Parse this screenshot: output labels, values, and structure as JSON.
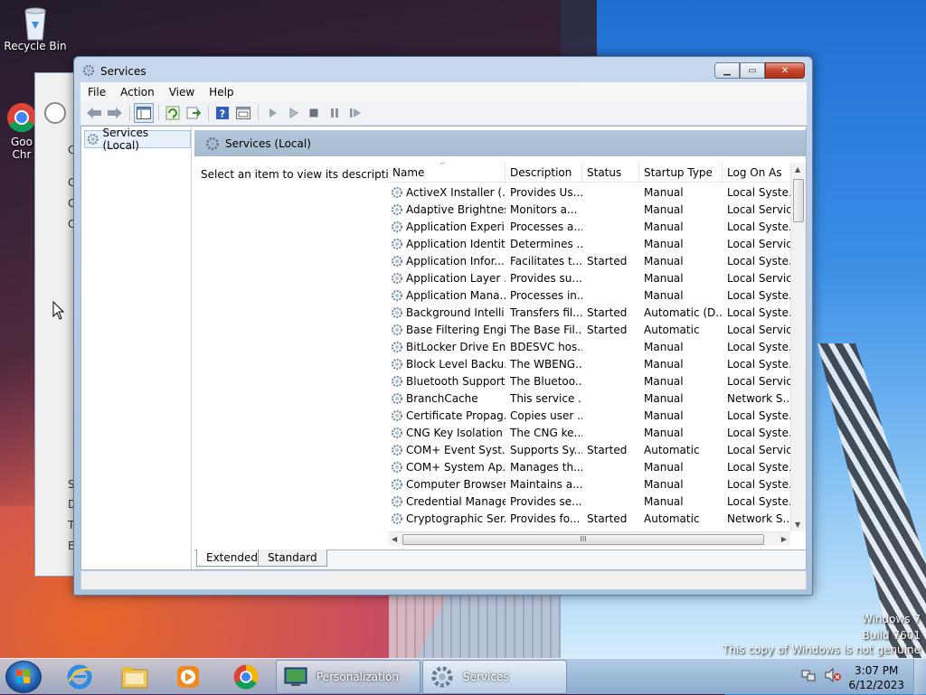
{
  "desktop": {
    "recycle_bin_label": "Recycle Bin",
    "chrome_label_line1": "Goo",
    "chrome_label_line2": "Chr",
    "watermark": {
      "line1": "Windows 7",
      "line2": "Build 7601",
      "line3": "This copy of Windows is not genuine"
    },
    "bg_window_fragments": [
      "C",
      "C",
      "C",
      "C",
      "S",
      "D",
      "T",
      "E"
    ]
  },
  "window": {
    "title": "Services",
    "menu": [
      "File",
      "Action",
      "View",
      "Help"
    ],
    "tree_item": "Services (Local)",
    "header": "Services (Local)",
    "description_prompt": "Select an item to view its description.",
    "columns": [
      "Name",
      "Description",
      "Status",
      "Startup Type",
      "Log On As"
    ],
    "services": [
      {
        "name": "ActiveX Installer (...",
        "description": "Provides Us...",
        "status": "",
        "startup": "Manual",
        "logon": "Local Syste..."
      },
      {
        "name": "Adaptive Brightness",
        "description": "Monitors a...",
        "status": "",
        "startup": "Manual",
        "logon": "Local Service"
      },
      {
        "name": "Application Experi...",
        "description": "Processes a...",
        "status": "",
        "startup": "Manual",
        "logon": "Local Syste..."
      },
      {
        "name": "Application Identity",
        "description": "Determines ...",
        "status": "",
        "startup": "Manual",
        "logon": "Local Service"
      },
      {
        "name": "Application Infor...",
        "description": "Facilitates t...",
        "status": "Started",
        "startup": "Manual",
        "logon": "Local Syste..."
      },
      {
        "name": "Application Layer ...",
        "description": "Provides su...",
        "status": "",
        "startup": "Manual",
        "logon": "Local Service"
      },
      {
        "name": "Application Mana...",
        "description": "Processes in...",
        "status": "",
        "startup": "Manual",
        "logon": "Local Syste..."
      },
      {
        "name": "Background Intelli...",
        "description": "Transfers fil...",
        "status": "Started",
        "startup": "Automatic (D...",
        "logon": "Local Syste..."
      },
      {
        "name": "Base Filtering Engi...",
        "description": "The Base Fil...",
        "status": "Started",
        "startup": "Automatic",
        "logon": "Local Service"
      },
      {
        "name": "BitLocker Drive En...",
        "description": "BDESVC hos...",
        "status": "",
        "startup": "Manual",
        "logon": "Local Syste..."
      },
      {
        "name": "Block Level Backu...",
        "description": "The WBENG...",
        "status": "",
        "startup": "Manual",
        "logon": "Local Syste..."
      },
      {
        "name": "Bluetooth Support...",
        "description": "The Bluetoo...",
        "status": "",
        "startup": "Manual",
        "logon": "Local Service"
      },
      {
        "name": "BranchCache",
        "description": "This service ...",
        "status": "",
        "startup": "Manual",
        "logon": "Network S..."
      },
      {
        "name": "Certificate Propag...",
        "description": "Copies user ...",
        "status": "",
        "startup": "Manual",
        "logon": "Local Syste..."
      },
      {
        "name": "CNG Key Isolation",
        "description": "The CNG ke...",
        "status": "",
        "startup": "Manual",
        "logon": "Local Syste..."
      },
      {
        "name": "COM+ Event Syst...",
        "description": "Supports Sy...",
        "status": "Started",
        "startup": "Automatic",
        "logon": "Local Service"
      },
      {
        "name": "COM+ System Ap...",
        "description": "Manages th...",
        "status": "",
        "startup": "Manual",
        "logon": "Local Syste..."
      },
      {
        "name": "Computer Browser",
        "description": "Maintains a...",
        "status": "",
        "startup": "Manual",
        "logon": "Local Syste..."
      },
      {
        "name": "Credential Manager",
        "description": "Provides se...",
        "status": "",
        "startup": "Manual",
        "logon": "Local Syste..."
      },
      {
        "name": "Cryptographic Ser...",
        "description": "Provides fo...",
        "status": "Started",
        "startup": "Automatic",
        "logon": "Network S..."
      }
    ],
    "tabs": [
      "Extended",
      "Standard"
    ],
    "hscroll_grip": "III"
  },
  "taskbar": {
    "tasks": [
      {
        "label": "Personalization"
      },
      {
        "label": "Services"
      }
    ],
    "clock_time": "3:07 PM",
    "clock_date": "6/12/2023"
  },
  "colors": {
    "accent": "#1e5aa8",
    "close_button": "#c4432b"
  }
}
